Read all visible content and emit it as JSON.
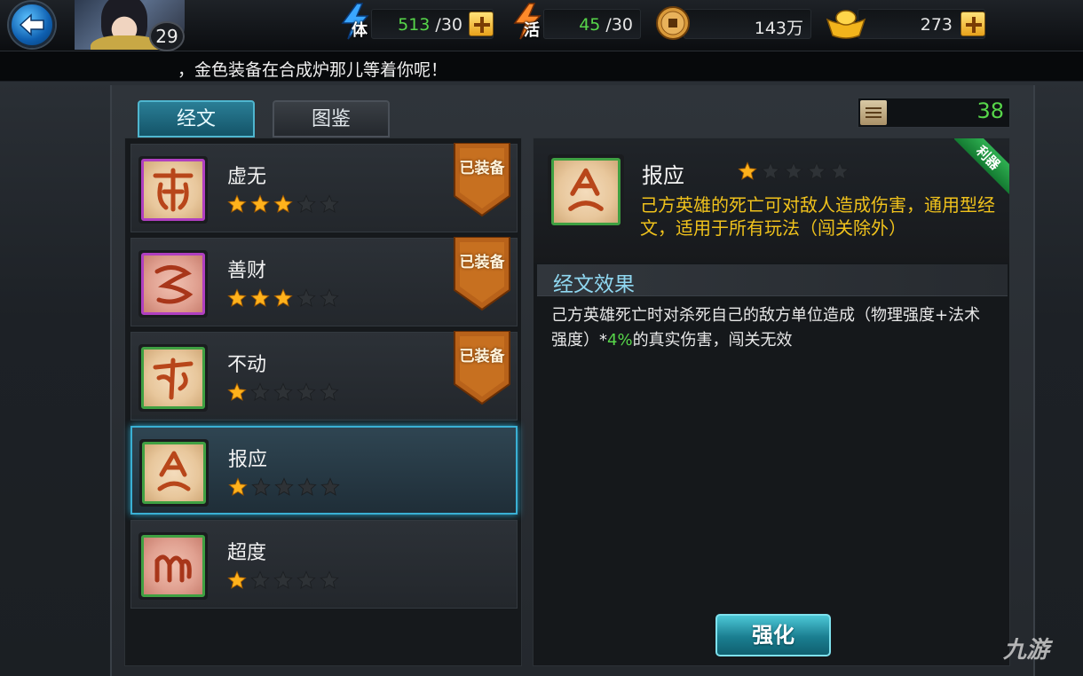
{
  "header": {
    "player_level": "29",
    "stamina": {
      "icon_text": "体",
      "current": "513",
      "max": "/30"
    },
    "energy": {
      "icon_text": "活",
      "current": "45",
      "max": "/30"
    },
    "coins": {
      "value": "143万"
    },
    "gold": {
      "value": "273"
    }
  },
  "notice": {
    "text": "，金色装备在合成炉那儿等着你呢！"
  },
  "tabs": [
    {
      "label": "经文",
      "active": true
    },
    {
      "label": "图鉴",
      "active": false
    }
  ],
  "scroll_count": "38",
  "list": [
    {
      "name": "虚无",
      "stars": 3,
      "frame": "purple",
      "equipped": true
    },
    {
      "name": "善财",
      "stars": 3,
      "frame": "purple",
      "equipped": true
    },
    {
      "name": "不动",
      "stars": 1,
      "frame": "green",
      "equipped": true
    },
    {
      "name": "报应",
      "stars": 1,
      "frame": "green",
      "equipped": false,
      "selected": true
    },
    {
      "name": "超度",
      "stars": 1,
      "frame": "green",
      "equipped": false
    }
  ],
  "equipped_label": "已装备",
  "detail": {
    "name": "报应",
    "stars": 1,
    "max_stars": 5,
    "ribbon": "利器",
    "description": "己方英雄的死亡可对敌人造成伤害，通用型经文，适用于所有玩法（闯关除外）",
    "effect_header": "经文效果",
    "effect_text_before": "己方英雄死亡时对杀死自己的敌方单位造成（物理强度+法术强度）*",
    "effect_highlight": "4%",
    "effect_text_after": "的真实伤害，闯关无效"
  },
  "enhance_button": "强化",
  "watermark": "九游",
  "colors": {
    "accent_blue": "#3ab0d4",
    "value_green": "#57d64a",
    "desc_yellow": "#f0c21c",
    "purple_frame": "#b03fc0",
    "green_frame": "#3fa042"
  }
}
